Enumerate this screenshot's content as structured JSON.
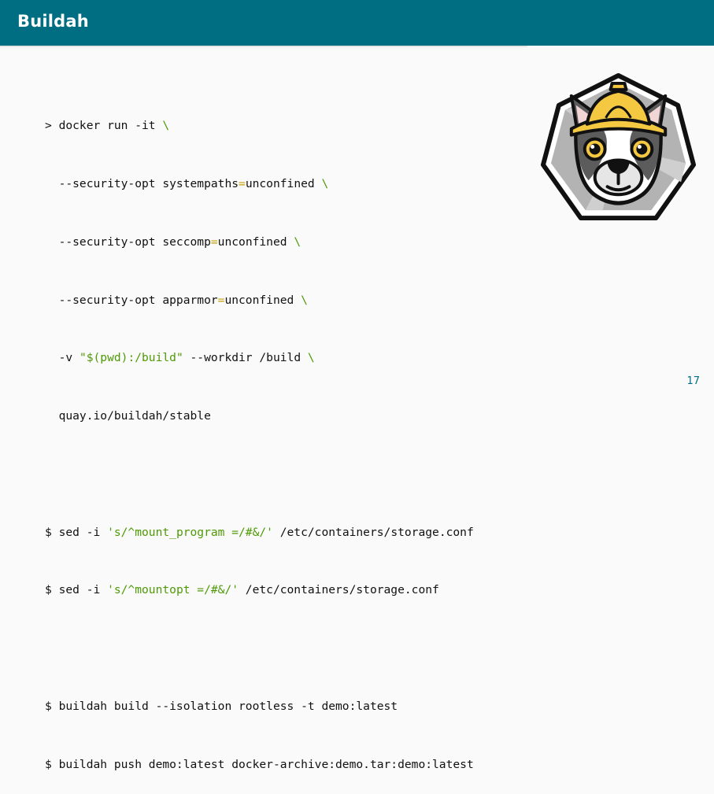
{
  "slide": {
    "title": "Buildah",
    "page_number": "17"
  },
  "code": {
    "l1_a": "> docker run -it ",
    "l1_bs": "\\",
    "l2_a": "  --security-opt systempaths",
    "l2_eq": "=",
    "l2_b": "unconfined ",
    "l2_bs": "\\",
    "l3_a": "  --security-opt seccomp",
    "l3_eq": "=",
    "l3_b": "unconfined ",
    "l3_bs": "\\",
    "l4_a": "  --security-opt apparmor",
    "l4_eq": "=",
    "l4_b": "unconfined ",
    "l4_bs": "\\",
    "l5_a": "  -v ",
    "l5_str": "\"$(pwd):/build\"",
    "l5_b": " --workdir /build ",
    "l5_bs": "\\",
    "l6": "  quay.io/buildah/stable",
    "l7_a": "$ sed -i ",
    "l7_str": "'s/^mount_program =/#&/'",
    "l7_b": " /etc/containers/storage.conf",
    "l8_a": "$ sed -i ",
    "l8_str": "'s/^mountopt =/#&/'",
    "l8_b": " /etc/containers/storage.conf",
    "l9": "$ buildah build --isolation rootless -t demo:latest",
    "l10": "$ buildah push demo:latest docker-archive:demo.tar:demo:latest"
  },
  "logo": {
    "icon": "buildah-dog-logo",
    "colors": {
      "hexagon": "#a9a9a9",
      "helmet": "#f5c842",
      "outline": "#111111"
    }
  },
  "colors": {
    "header": "#006e82",
    "string": "#4e9a06",
    "operator": "#c4a000",
    "page_number": "#006e82"
  }
}
